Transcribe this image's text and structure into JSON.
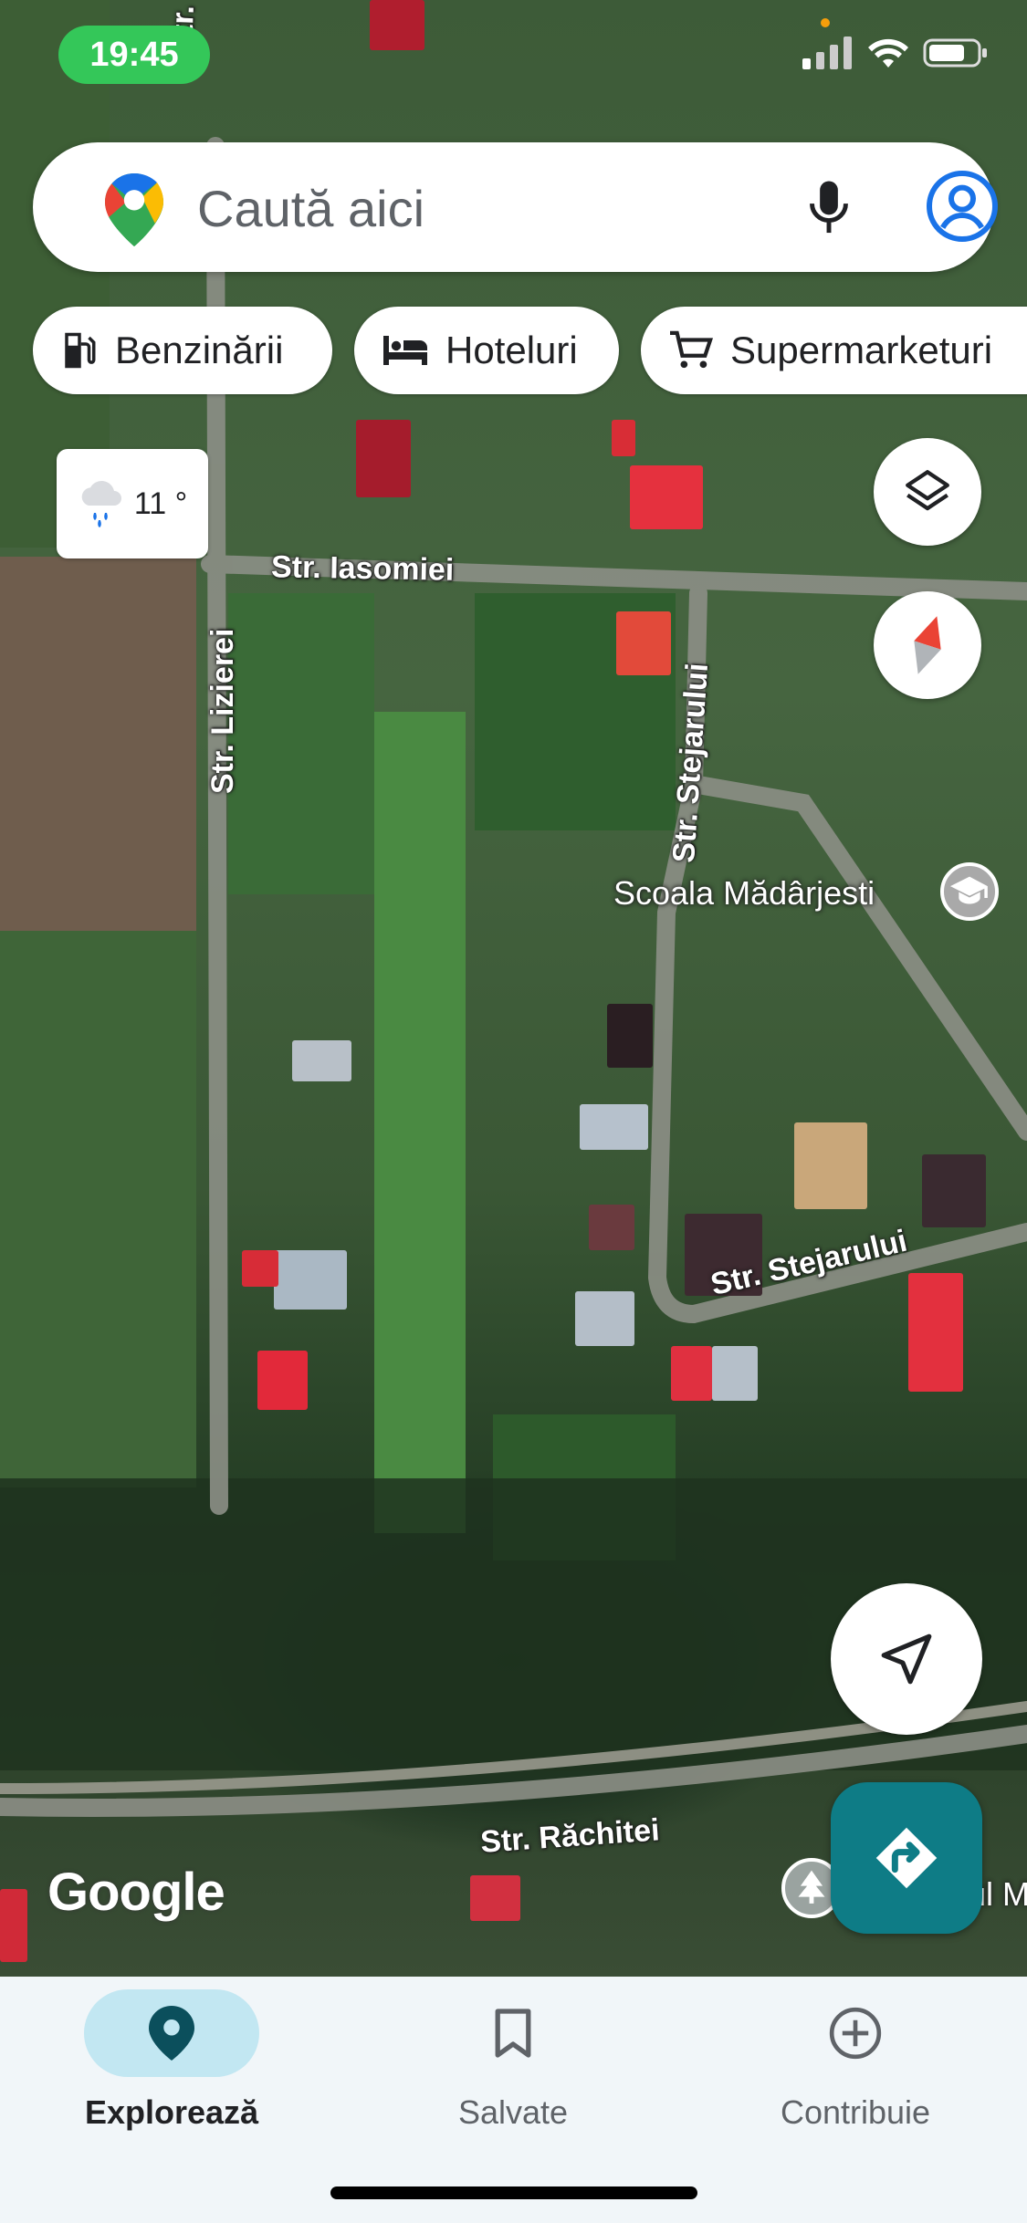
{
  "status_bar": {
    "time": "19:45"
  },
  "search": {
    "placeholder": "Caută aici"
  },
  "chips": [
    {
      "label": "Benzinării",
      "icon": "gas-station-icon"
    },
    {
      "label": "Hoteluri",
      "icon": "hotel-bed-icon"
    },
    {
      "label": "Supermarketuri",
      "icon": "shopping-cart-icon"
    }
  ],
  "weather": {
    "temp": "11 °",
    "icon": "rain-cloud-icon"
  },
  "map": {
    "roads": [
      {
        "label": "Str. Lizierei"
      },
      {
        "label": "Str. Lizierei"
      },
      {
        "label": "Str. Iasomiei"
      },
      {
        "label": "Str. Stejarului"
      },
      {
        "label": "Str. Stejarului"
      },
      {
        "label": "Str. Răchitei"
      }
    ],
    "poi": {
      "label": "Scoala Mădârjesti",
      "icon": "school-icon"
    },
    "partial_label": "ul M",
    "logo": "Google"
  },
  "bottom_nav": {
    "items": [
      {
        "label": "Explorează",
        "icon": "location-pin-icon",
        "active": true
      },
      {
        "label": "Salvate",
        "icon": "bookmark-icon",
        "active": false
      },
      {
        "label": "Contribuie",
        "icon": "add-circle-icon",
        "active": false
      }
    ]
  },
  "colors": {
    "accent": "#0e7c86",
    "active_pill": "#c2e7f2",
    "status_green": "#34c759"
  }
}
